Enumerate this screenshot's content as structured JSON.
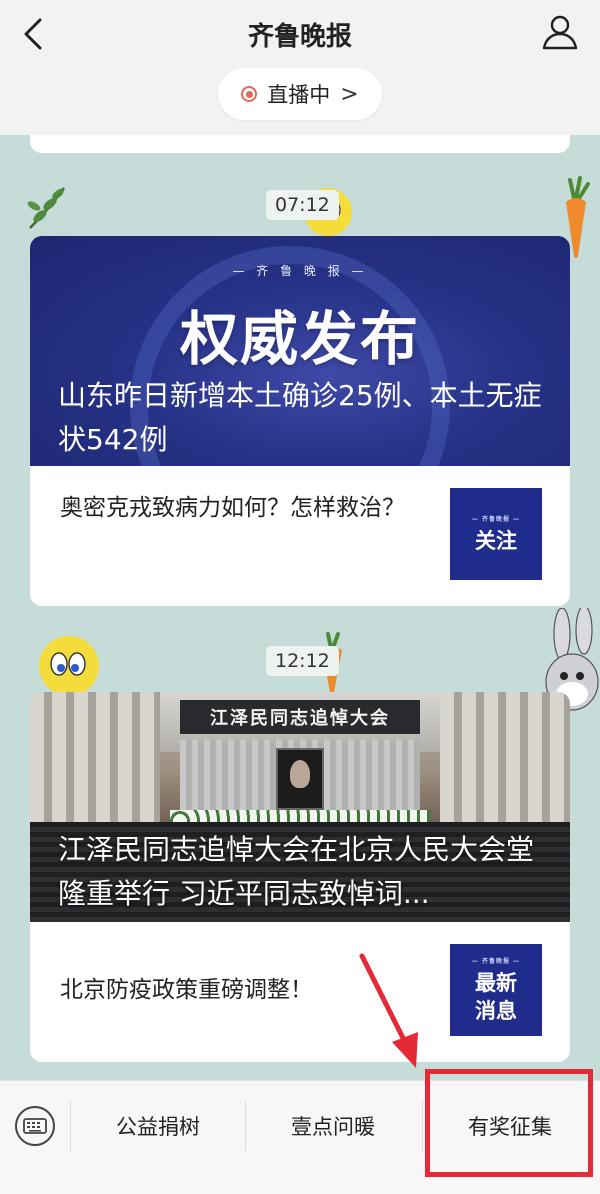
{
  "header": {
    "title": "齐鲁晚报",
    "live_label": "直播中",
    "live_chevron": ">"
  },
  "feed": [
    {
      "time": "07:12",
      "banner_brand": "— 齐 鲁 晚 报 —",
      "banner_title": "权威发布",
      "banner_headline": "山东昨日新增本土确诊25例、本土无症状542例",
      "text": "奥密克戎致病力如何？怎样救治？",
      "thumb_brand": "— 齐鲁晚报 —",
      "thumb_word": "关注"
    },
    {
      "time": "12:12",
      "stage_banner": "江泽民同志追悼大会",
      "banner_headline": "江泽民同志追悼大会在北京人民大会堂隆重举行 习近平同志致悼词...",
      "text": "北京防疫政策重磅调整！",
      "thumb_brand": "— 齐鲁晚报 —",
      "thumb_word_1": "最新",
      "thumb_word_2": "消息"
    }
  ],
  "bottom_bar": {
    "tabs": [
      "公益捐树",
      "壹点问暖",
      "有奖征集"
    ]
  },
  "colors": {
    "background": "#c5dcd9",
    "header_bg": "#f2f2f2",
    "banner_blue": "#263286",
    "thumb_blue": "#1f2c8c",
    "live_red": "#e06a5a",
    "annotation_red": "#e52a37"
  },
  "icons": {
    "back": "chevron-left-icon",
    "user": "user-icon",
    "keyboard": "keyboard-icon"
  }
}
